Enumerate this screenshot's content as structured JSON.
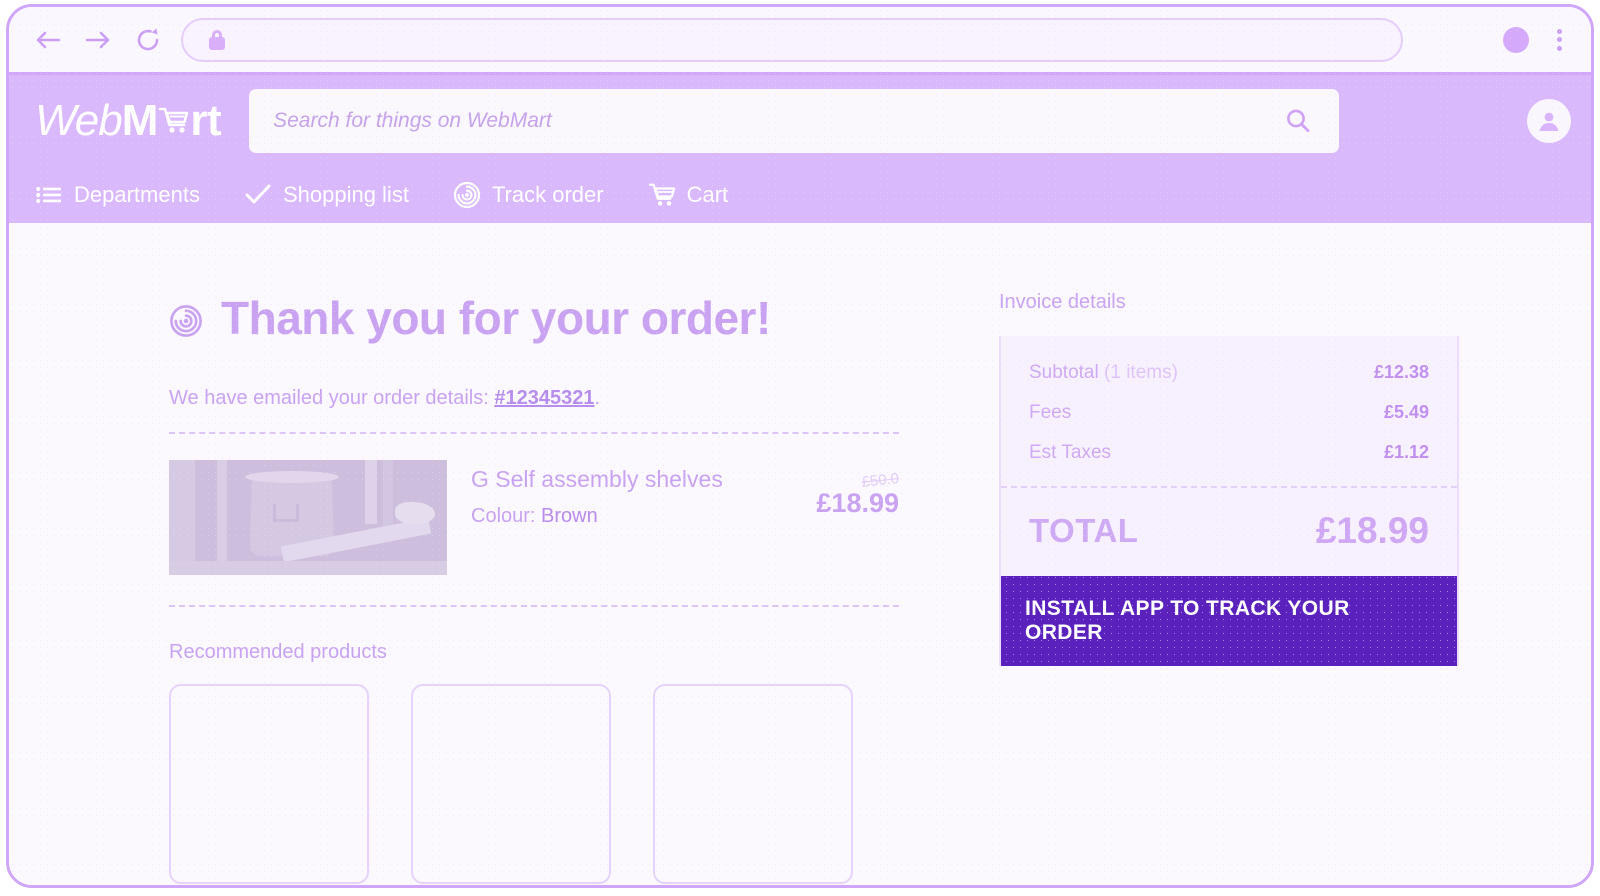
{
  "browser": {
    "back_icon": "arrow-left-icon",
    "forward_icon": "arrow-right-icon",
    "reload_icon": "reload-icon",
    "lock_icon": "lock-icon",
    "url_value": "",
    "url_placeholder": "",
    "profile_icon": "profile-avatar-dot",
    "menu_icon": "kebab-menu-icon"
  },
  "header": {
    "brand": {
      "part1": "Web",
      "part2": "M",
      "cart_glyph": "shopping-cart-icon",
      "part3": "rt"
    },
    "search": {
      "placeholder": "Search for things on WebMart",
      "value": "",
      "button_icon": "search-icon"
    },
    "account_icon": "account-circle-icon",
    "nav": [
      {
        "label": "Departments",
        "icon": "list-menu-icon"
      },
      {
        "label": "Shopping list",
        "icon": "check-icon"
      },
      {
        "label": "Track order",
        "icon": "target-radar-icon"
      },
      {
        "label": "Cart",
        "icon": "shopping-cart-icon"
      }
    ]
  },
  "main": {
    "heading_icon": "target-radar-icon",
    "heading": "Thank you for your order!",
    "emailed_prefix": "We have emailed your order details: ",
    "order_number": "#12345321",
    "emailed_suffix": ".",
    "product": {
      "image_alt": "self-assembly-shelves-photo",
      "title": "G Self assembly shelves",
      "colour_label": "Colour:",
      "colour_value": "Brown",
      "price_old": "£50.0",
      "price_new": "£18.99"
    },
    "recommended_title": "Recommended products",
    "recommended_cards": [
      "",
      "",
      ""
    ]
  },
  "invoice": {
    "title": "Invoice details",
    "rows": [
      {
        "label": "Subtotal",
        "sublabel": "(1 items)",
        "value": "£12.38"
      },
      {
        "label": "Fees",
        "sublabel": "",
        "value": "£5.49"
      },
      {
        "label": "Est Taxes",
        "sublabel": "",
        "value": "£1.12"
      }
    ],
    "total_label": "TOTAL",
    "total_value": "£18.99",
    "cta_label": "INSTALL APP TO TRACK YOUR ORDER"
  },
  "colors": {
    "header_purple": "#dab8fc",
    "accent_light": "#c9a3f2",
    "cta_dark": "#5b21bd",
    "page_bg": "#fbf8fe",
    "card_bg": "#f7f1fe"
  }
}
